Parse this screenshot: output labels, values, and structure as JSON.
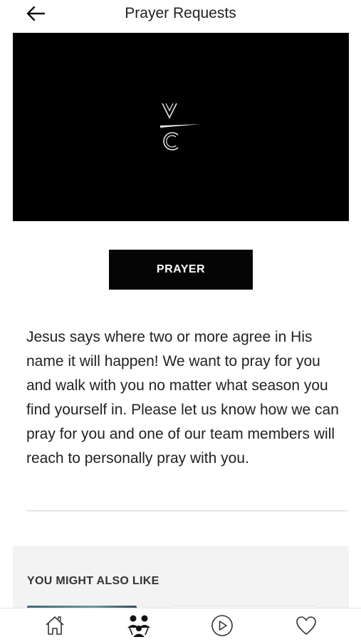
{
  "header": {
    "title": "Prayer Requests",
    "back_icon": "arrow-left-icon"
  },
  "video": {
    "logo": "vc-logo",
    "background": "#000000"
  },
  "actions": {
    "prayer_button_label": "PRAYER"
  },
  "content": {
    "description": "Jesus says where two or more agree in His name it will happen! We want to pray for you and walk with you no matter what season you find yourself in. Please let us know how we can pray for you and one of our team members will reach to personally pray with you."
  },
  "recommendations": {
    "title": "YOU MIGHT ALSO LIKE"
  },
  "tabbar": {
    "items": [
      {
        "icon": "home-icon"
      },
      {
        "icon": "people-icon"
      },
      {
        "icon": "play-icon"
      },
      {
        "icon": "heart-icon"
      }
    ]
  },
  "colors": {
    "button_bg": "#050505",
    "section_bg": "#f3f3f3"
  }
}
